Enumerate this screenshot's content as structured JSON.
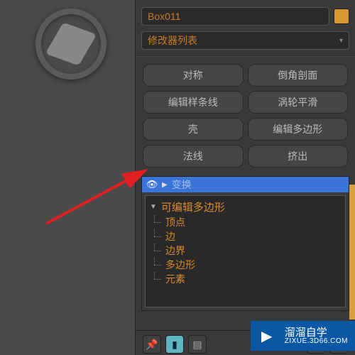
{
  "object_name": "Box011",
  "object_color": "#d89830",
  "modifier_list_label": "修改器列表",
  "modifier_buttons": [
    {
      "label": "对称"
    },
    {
      "label": "倒角剖面"
    },
    {
      "label": "编辑样条线"
    },
    {
      "label": "涡轮平滑"
    },
    {
      "label": "壳"
    },
    {
      "label": "编辑多边形"
    },
    {
      "label": "法线"
    },
    {
      "label": "挤出"
    }
  ],
  "stack": {
    "selected_modifier": "变换",
    "base_object": "可编辑多边形",
    "sub_objects": [
      "顶点",
      "边",
      "边界",
      "多边形",
      "元素"
    ]
  },
  "toolbar_icons": {
    "pin": "📌",
    "vertex": "▮",
    "config": "▤",
    "delete": "🗑",
    "options": "⚙"
  },
  "watermark": {
    "brand": "溜溜自学",
    "url": "ZIXUE.3D66.COM"
  }
}
